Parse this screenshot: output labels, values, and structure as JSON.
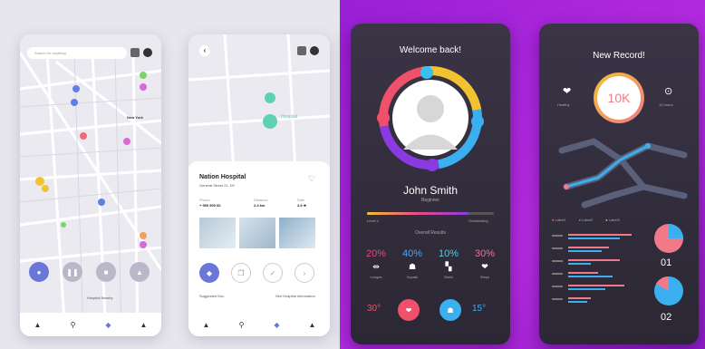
{
  "phone_map": {
    "search_placeholder": "Search for anything",
    "city_label": "New York",
    "bottom_label": "Hospital Nearby",
    "nav": [
      "person-icon",
      "search-icon",
      "pin-icon",
      "bell-icon"
    ]
  },
  "phone_hospital": {
    "map_label": "Hospital",
    "name": "Nation Hospital",
    "address": "General Street 21, NY",
    "stats": [
      {
        "label": "Phone",
        "value": "+ 990 500 60"
      },
      {
        "label": "Distance",
        "value": "2,4 km"
      },
      {
        "label": "Rate",
        "value": "4.9 ★"
      }
    ],
    "footer_left": "Suggested Doc",
    "footer_right": "See Hospital Information",
    "nav": [
      "person-icon",
      "search-icon",
      "pin-icon",
      "bell-icon"
    ]
  },
  "phone_profile": {
    "title": "Welcome back!",
    "name": "John Smith",
    "subtitle": "Beginner",
    "progress_left": "Level 4",
    "progress_right": "Outstanding",
    "progress_level": 0.8,
    "section_label": "Overall Results",
    "stats": [
      {
        "pct": "20%",
        "label": "Lunges",
        "color": "#e8467c"
      },
      {
        "pct": "40%",
        "label": "Squats",
        "color": "#4aa7f0"
      },
      {
        "pct": "10%",
        "label": "Stairs",
        "color": "#48d6e0"
      },
      {
        "pct": "30%",
        "label": "Steps",
        "color": "#f2709a"
      }
    ],
    "bottom_left": "30°",
    "bottom_right": "15°"
  },
  "phone_record": {
    "title": "New Record!",
    "record_value": "10K",
    "left_label": "Healthy",
    "right_label": "12 hours",
    "legend": [
      "Label1",
      "Label2",
      "Label3"
    ],
    "bars": [
      {
        "a": 0.85,
        "b": 0.7
      },
      {
        "a": 0.55,
        "b": 0.45
      },
      {
        "a": 0.7,
        "b": 0.3
      },
      {
        "a": 0.4,
        "b": 0.6
      },
      {
        "a": 0.75,
        "b": 0.5
      },
      {
        "a": 0.3,
        "b": 0.25
      }
    ],
    "pie_label_1": "01",
    "pie_label_2": "02",
    "colors": {
      "accent": "#f07a8a",
      "blue": "#3ab0f0",
      "yellow": "#f2c230"
    }
  }
}
